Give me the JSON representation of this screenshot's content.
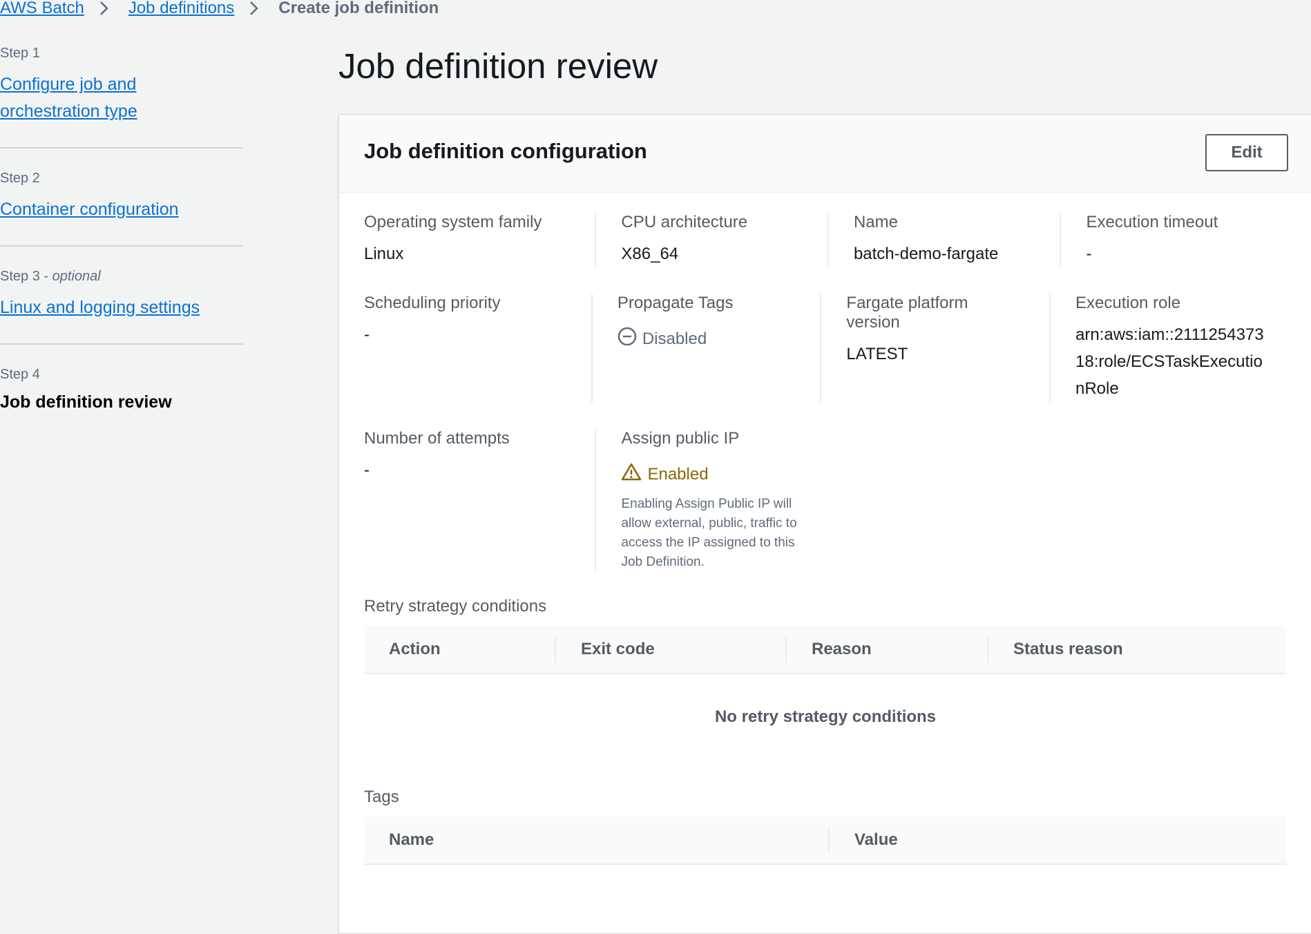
{
  "breadcrumb": {
    "items": [
      "AWS Batch",
      "Job definitions"
    ],
    "current": "Create job definition"
  },
  "wizard": {
    "steps": [
      {
        "num": "Step 1",
        "label": "Configure job and orchestration type"
      },
      {
        "num": "Step 2",
        "label": "Container configuration"
      },
      {
        "num": "Step 3",
        "optional": "optional",
        "label": "Linux and logging settings"
      },
      {
        "num": "Step 4",
        "label": "Job definition review"
      }
    ]
  },
  "page": {
    "title": "Job definition review"
  },
  "panel": {
    "title": "Job definition configuration",
    "edit_label": "Edit",
    "fields": {
      "os_family": {
        "label": "Operating system family",
        "value": "Linux"
      },
      "cpu_arch": {
        "label": "CPU architecture",
        "value": "X86_64"
      },
      "name": {
        "label": "Name",
        "value": "batch-demo-fargate"
      },
      "exec_timeout": {
        "label": "Execution timeout",
        "value": "-"
      },
      "sched_priority": {
        "label": "Scheduling priority",
        "value": "-"
      },
      "propagate_tags": {
        "label": "Propagate Tags",
        "value": "Disabled"
      },
      "fargate_version": {
        "label": "Fargate platform version",
        "value": "LATEST"
      },
      "exec_role": {
        "label": "Execution role",
        "value": "arn:aws:iam::211125437318:role/ECSTaskExecutionRole"
      },
      "attempts": {
        "label": "Number of attempts",
        "value": "-"
      },
      "public_ip": {
        "label": "Assign public IP",
        "value": "Enabled",
        "description": "Enabling Assign Public IP will allow external, public, traffic to access the IP assigned to this Job Definition."
      }
    },
    "retry": {
      "label": "Retry strategy conditions",
      "columns": [
        "Action",
        "Exit code",
        "Reason",
        "Status reason"
      ],
      "empty": "No retry strategy conditions"
    },
    "tags": {
      "label": "Tags",
      "columns": [
        "Name",
        "Value"
      ]
    }
  },
  "colors": {
    "link": "#0972d3",
    "warning": "#8d6605",
    "text": "#16191f",
    "secondary": "#545b64",
    "background": "#f2f3f3"
  }
}
